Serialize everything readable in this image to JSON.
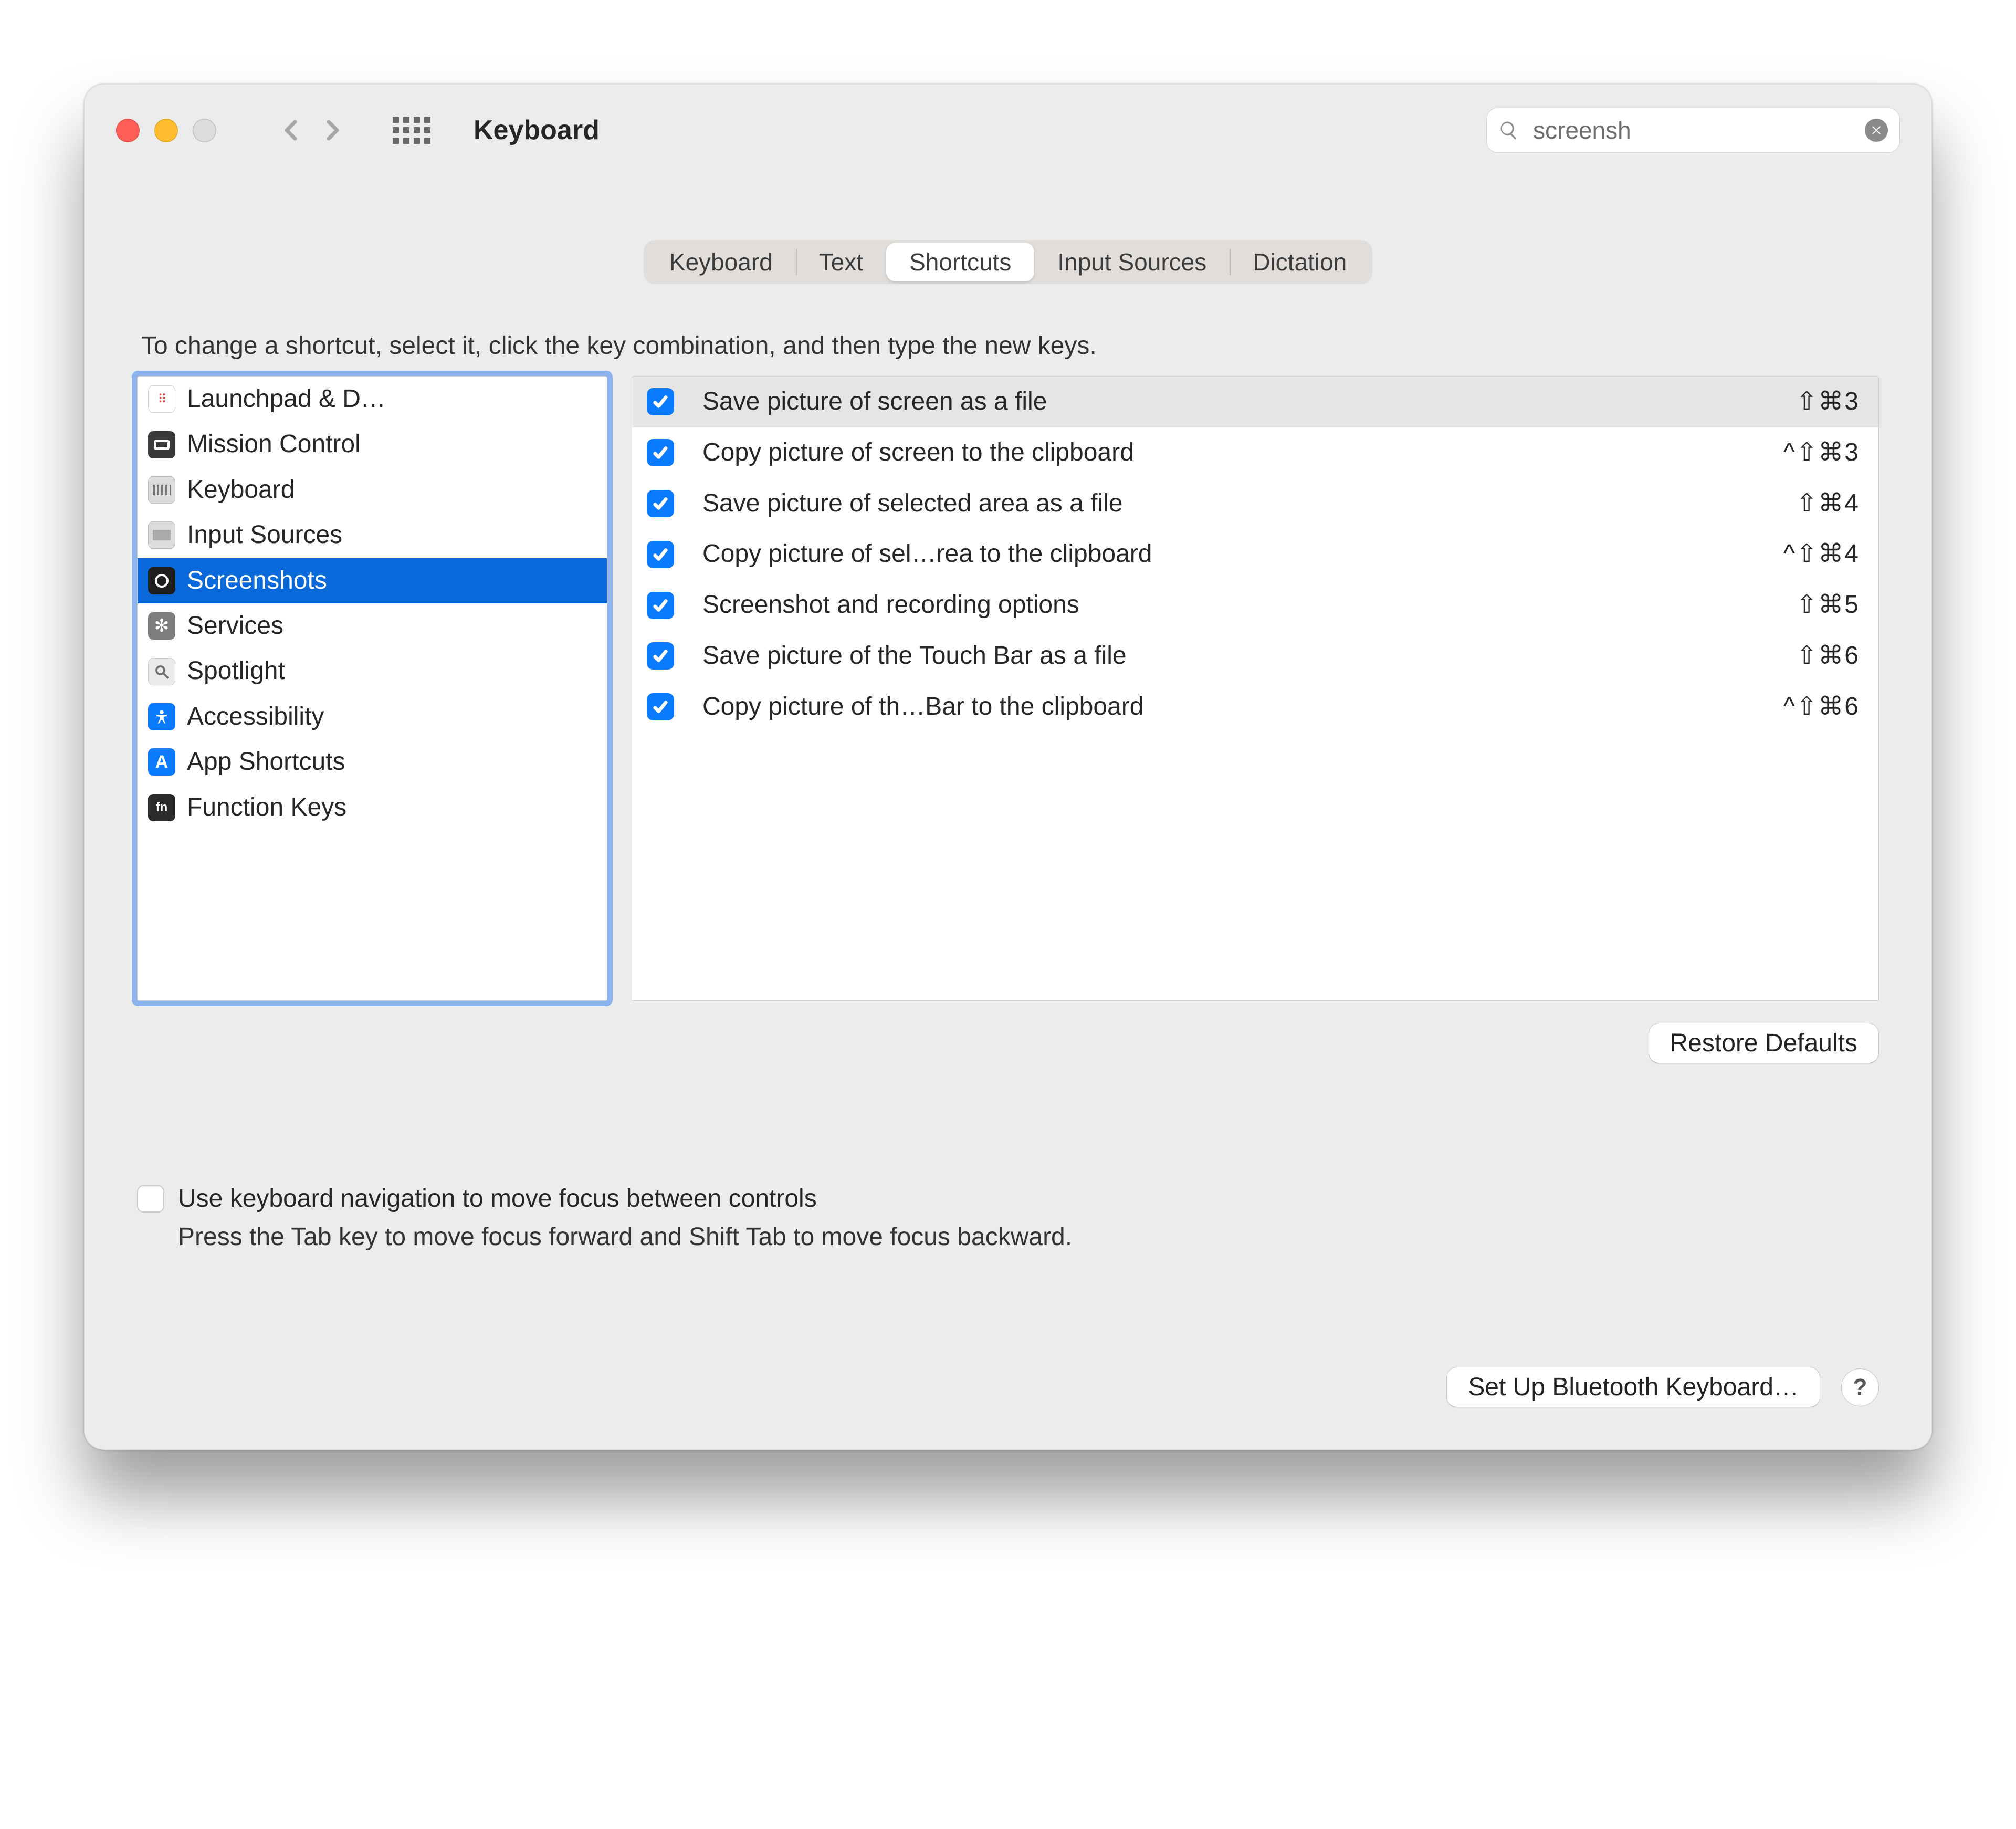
{
  "window": {
    "title": "Keyboard"
  },
  "search": {
    "value": "screensh",
    "placeholder": "Search"
  },
  "tabs": [
    {
      "label": "Keyboard",
      "selected": false
    },
    {
      "label": "Text",
      "selected": false
    },
    {
      "label": "Shortcuts",
      "selected": true
    },
    {
      "label": "Input Sources",
      "selected": false
    },
    {
      "label": "Dictation",
      "selected": false
    }
  ],
  "instruction": "To change a shortcut, select it, click the key combination, and then type the new keys.",
  "sidebar": {
    "items": [
      {
        "label": "Launchpad & D…",
        "icon": "launchpad",
        "selected": false
      },
      {
        "label": "Mission Control",
        "icon": "mission-control",
        "selected": false
      },
      {
        "label": "Keyboard",
        "icon": "keyboard",
        "selected": false
      },
      {
        "label": "Input Sources",
        "icon": "input-sources",
        "selected": false
      },
      {
        "label": "Screenshots",
        "icon": "screenshots",
        "selected": true
      },
      {
        "label": "Services",
        "icon": "services",
        "selected": false
      },
      {
        "label": "Spotlight",
        "icon": "spotlight",
        "selected": false
      },
      {
        "label": "Accessibility",
        "icon": "accessibility",
        "selected": false
      },
      {
        "label": "App Shortcuts",
        "icon": "app-shortcuts",
        "selected": false
      },
      {
        "label": "Function Keys",
        "icon": "function-keys",
        "selected": false
      }
    ]
  },
  "shortcuts": [
    {
      "checked": true,
      "label": "Save picture of screen as a file",
      "keys": "⇧⌘3",
      "highlighted": true
    },
    {
      "checked": true,
      "label": "Copy picture of screen to the clipboard",
      "keys": "^⇧⌘3",
      "highlighted": false
    },
    {
      "checked": true,
      "label": "Save picture of selected area as a file",
      "keys": "⇧⌘4",
      "highlighted": false
    },
    {
      "checked": true,
      "label": "Copy picture of sel…rea to the clipboard",
      "keys": "^⇧⌘4",
      "highlighted": false
    },
    {
      "checked": true,
      "label": "Screenshot and recording options",
      "keys": "⇧⌘5",
      "highlighted": false
    },
    {
      "checked": true,
      "label": "Save picture of the Touch Bar as a file",
      "keys": "⇧⌘6",
      "highlighted": false
    },
    {
      "checked": true,
      "label": "Copy picture of th…Bar to the clipboard",
      "keys": "^⇧⌘6",
      "highlighted": false
    }
  ],
  "buttons": {
    "restore_defaults": "Restore Defaults",
    "setup_bluetooth": "Set Up Bluetooth Keyboard…",
    "help": "?"
  },
  "nav_option": {
    "checked": false,
    "label": "Use keyboard navigation to move focus between controls",
    "subtext": "Press the Tab key to move focus forward and Shift Tab to move focus backward."
  },
  "icons": {
    "launchpad_glyph": "⋮⋮⋮",
    "fn_glyph": "fn"
  }
}
